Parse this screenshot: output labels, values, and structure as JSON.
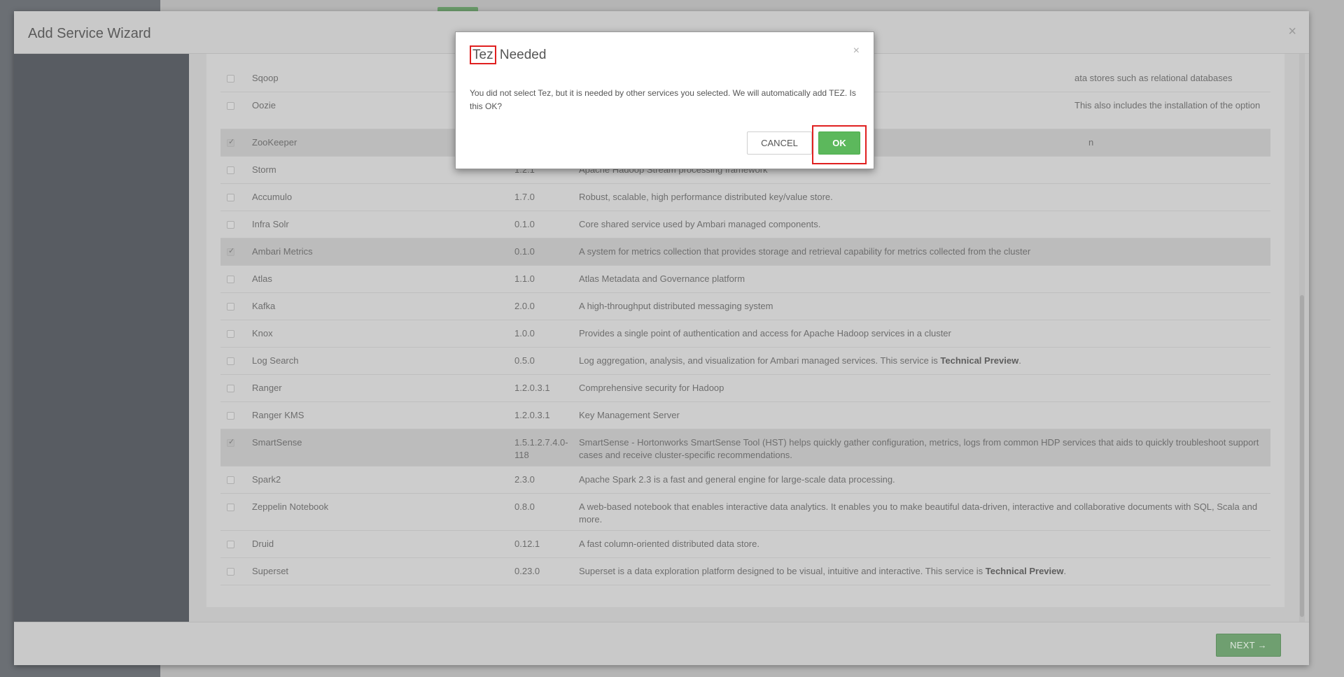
{
  "wizard": {
    "title": "Add Service Wizard",
    "close_icon": "×",
    "next_label": "NEXT →"
  },
  "dialog": {
    "title_highlight": "Tez",
    "title_rest": " Needed",
    "close_icon": "×",
    "message": "You did not select Tez, but it is needed by other services you selected. We will automatically add TEZ. Is this OK?",
    "cancel_label": "CANCEL",
    "ok_label": "OK"
  },
  "services": [
    {
      "name": "Sqoop",
      "version": "",
      "description": "ata stores such as relational databases",
      "selected": false
    },
    {
      "name": "Oozie",
      "version": "",
      "description": "This also includes the installation of the optional Oozie Web Console which relies on and will",
      "selected": false
    },
    {
      "name": "ZooKeeper",
      "version": "",
      "description": "n",
      "selected": true
    },
    {
      "name": "Storm",
      "version": "1.2.1",
      "description": "Apache Hadoop Stream processing framework",
      "selected": false
    },
    {
      "name": "Accumulo",
      "version": "1.7.0",
      "description": "Robust, scalable, high performance distributed key/value store.",
      "selected": false
    },
    {
      "name": "Infra Solr",
      "version": "0.1.0",
      "description": "Core shared service used by Ambari managed components.",
      "selected": false
    },
    {
      "name": "Ambari Metrics",
      "version": "0.1.0",
      "description": "A system for metrics collection that provides storage and retrieval capability for metrics collected from the cluster",
      "selected": true
    },
    {
      "name": "Atlas",
      "version": "1.1.0",
      "description": "Atlas Metadata and Governance platform",
      "selected": false
    },
    {
      "name": "Kafka",
      "version": "2.0.0",
      "description": "A high-throughput distributed messaging system",
      "selected": false
    },
    {
      "name": "Knox",
      "version": "1.0.0",
      "description": "Provides a single point of authentication and access for Apache Hadoop services in a cluster",
      "selected": false
    },
    {
      "name": "Log Search",
      "version": "0.5.0",
      "description": "Log aggregation, analysis, and visualization for Ambari managed services. This service is ",
      "description_bold": "Technical Preview",
      "description_tail": ".",
      "selected": false
    },
    {
      "name": "Ranger",
      "version": "1.2.0.3.1",
      "description": "Comprehensive security for Hadoop",
      "selected": false
    },
    {
      "name": "Ranger KMS",
      "version": "1.2.0.3.1",
      "description": "Key Management Server",
      "selected": false
    },
    {
      "name": "SmartSense",
      "version": "1.5.1.2.7.4.0-118",
      "description": "SmartSense - Hortonworks SmartSense Tool (HST) helps quickly gather configuration, metrics, logs from common HDP services that aids to quickly troubleshoot support cases and receive cluster-specific recommendations.",
      "selected": true
    },
    {
      "name": "Spark2",
      "version": "2.3.0",
      "description": "Apache Spark 2.3 is a fast and general engine for large-scale data processing.",
      "selected": false
    },
    {
      "name": "Zeppelin Notebook",
      "version": "0.8.0",
      "description": "A web-based notebook that enables interactive data analytics. It enables you to make beautiful data-driven, interactive and collaborative documents with SQL, Scala and more.",
      "selected": false
    },
    {
      "name": "Druid",
      "version": "0.12.1",
      "description": "A fast column-oriented distributed data store.",
      "selected": false
    },
    {
      "name": "Superset",
      "version": "0.23.0",
      "description": "Superset is a data exploration platform designed to be visual, intuitive and interactive. This service is ",
      "description_bold": "Technical Preview",
      "description_tail": ".",
      "selected": false
    }
  ]
}
